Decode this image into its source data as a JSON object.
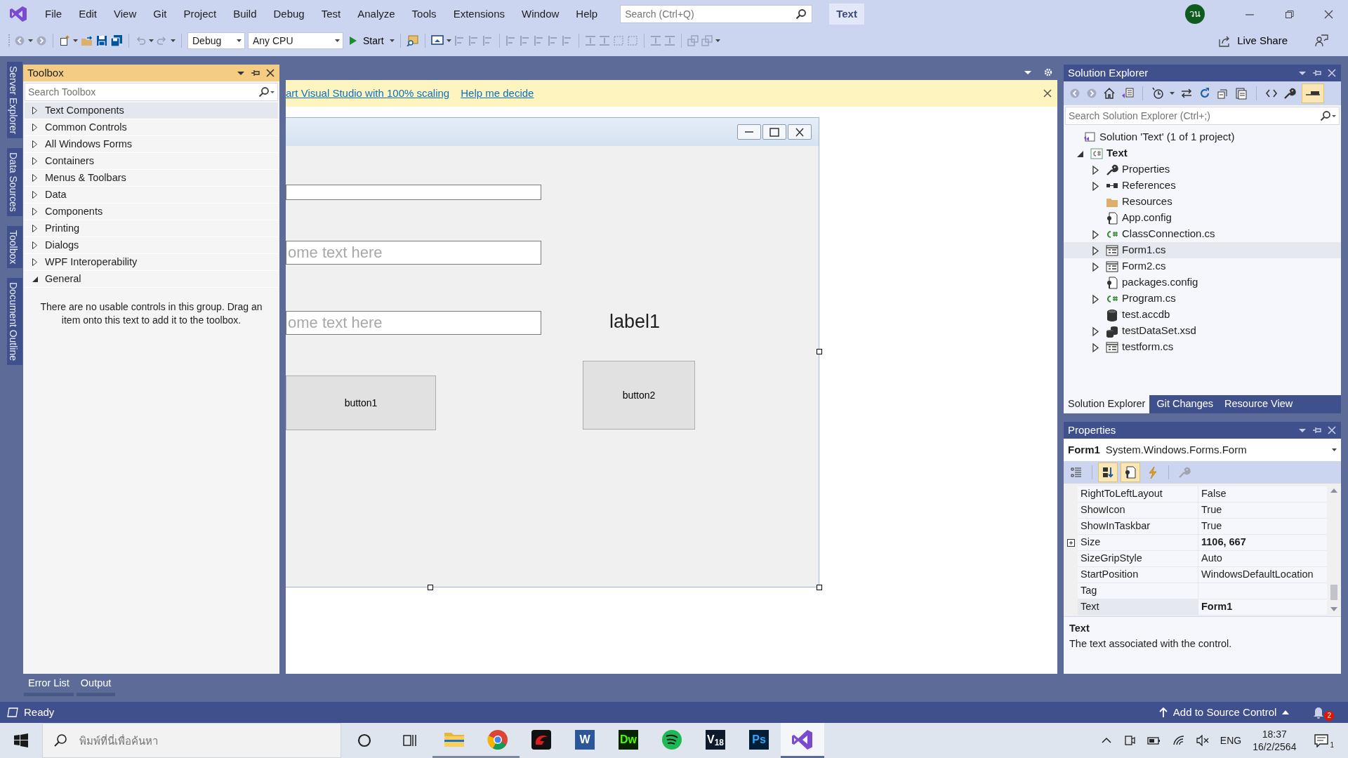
{
  "title_bar": {
    "menu": [
      {
        "label": "File"
      },
      {
        "label": "Edit"
      },
      {
        "label": "View"
      },
      {
        "label": "Git"
      },
      {
        "label": "Project"
      },
      {
        "label": "Build"
      },
      {
        "label": "Debug"
      },
      {
        "label": "Test"
      },
      {
        "label": "Analyze"
      },
      {
        "label": "Tools"
      },
      {
        "label": "Extensions"
      },
      {
        "label": "Window"
      },
      {
        "label": "Help"
      }
    ],
    "search": {
      "placeholder": "Search (Ctrl+Q)"
    },
    "solution_badge": "Text",
    "avatar": "วน"
  },
  "toolbar": {
    "configuration": "Debug",
    "platform": "Any CPU",
    "start": "Start",
    "live_share": "Live Share"
  },
  "side_tabs": [
    {
      "label": "Server Explorer"
    },
    {
      "label": "Data Sources"
    },
    {
      "label": "Toolbox"
    },
    {
      "label": "Document Outline"
    }
  ],
  "toolbox": {
    "title": "Toolbox",
    "search": {
      "placeholder": "Search Toolbox"
    },
    "groups": [
      {
        "label": "Text Components",
        "expanded": false,
        "selected": true
      },
      {
        "label": "Common Controls",
        "expanded": false,
        "selected": false
      },
      {
        "label": "All Windows Forms",
        "expanded": false,
        "selected": false
      },
      {
        "label": "Containers",
        "expanded": false,
        "selected": false
      },
      {
        "label": "Menus & Toolbars",
        "expanded": false,
        "selected": false
      },
      {
        "label": "Data",
        "expanded": false,
        "selected": false
      },
      {
        "label": "Components",
        "expanded": false,
        "selected": false
      },
      {
        "label": "Printing",
        "expanded": false,
        "selected": false
      },
      {
        "label": "Dialogs",
        "expanded": false,
        "selected": false
      },
      {
        "label": "WPF Interoperability",
        "expanded": false,
        "selected": false
      },
      {
        "label": "General",
        "expanded": true,
        "selected": false
      }
    ],
    "empty_message": "There are no usable controls in this group. Drag an item onto this text to add it to the toolbox."
  },
  "designer": {
    "infobar": {
      "message": "art Visual Studio with 100% scaling",
      "link": "Help me decide"
    },
    "form_controls": [
      {
        "kind": "textbox"
      },
      {
        "kind": "textbox",
        "placeholder": "ome text here"
      },
      {
        "kind": "textbox",
        "placeholder": "ome text here"
      },
      {
        "kind": "label",
        "text": "label1"
      },
      {
        "kind": "button",
        "text": "button2"
      },
      {
        "kind": "button",
        "text": "button1"
      }
    ]
  },
  "solution_explorer": {
    "title": "Solution Explorer",
    "preview_toggle": true,
    "search": {
      "placeholder": "Search Solution Explorer (Ctrl+;)"
    },
    "tree": [
      {
        "label": "Solution 'Text' (1 of 1 project)",
        "kind": "solution",
        "expandable": false,
        "selected": false,
        "children": [
          {
            "label": "Text",
            "kind": "project",
            "expandable": true,
            "expanded": true,
            "selected": false,
            "children": [
              {
                "label": "Properties",
                "kind": "wrench",
                "expandable": true,
                "expanded": false,
                "selected": false
              },
              {
                "label": "References",
                "kind": "references",
                "expandable": true,
                "expanded": false,
                "selected": false
              },
              {
                "label": "Resources",
                "kind": "folder",
                "expandable": false,
                "selected": false
              },
              {
                "label": "App.config",
                "kind": "config",
                "expandable": false,
                "selected": false
              },
              {
                "label": "ClassConnection.cs",
                "kind": "csharp",
                "expandable": true,
                "expanded": false,
                "selected": false
              },
              {
                "label": "Form1.cs",
                "kind": "form",
                "expandable": true,
                "expanded": false,
                "selected": true
              },
              {
                "label": "Form2.cs",
                "kind": "form",
                "expandable": true,
                "expanded": false,
                "selected": false
              },
              {
                "label": "packages.config",
                "kind": "config",
                "expandable": false,
                "selected": false
              },
              {
                "label": "Program.cs",
                "kind": "csharp",
                "expandable": true,
                "expanded": false,
                "selected": false
              },
              {
                "label": "test.accdb",
                "kind": "database",
                "expandable": false,
                "selected": false
              },
              {
                "label": "testDataSet.xsd",
                "kind": "dataset",
                "expandable": true,
                "expanded": false,
                "selected": false
              },
              {
                "label": "testform.cs",
                "kind": "form",
                "expandable": true,
                "expanded": false,
                "selected": false
              }
            ]
          }
        ]
      }
    ],
    "tabs": [
      {
        "label": "Solution Explorer",
        "selected": true
      },
      {
        "label": "Git Changes",
        "selected": false
      },
      {
        "label": "Resource View",
        "selected": false
      }
    ]
  },
  "properties": {
    "title": "Properties",
    "object": "Form1",
    "type": "System.Windows.Forms.Form",
    "view_buttons": [
      {
        "kind": "categorized",
        "selected": false
      },
      {
        "kind": "alphabetical",
        "selected": true
      },
      {
        "kind": "property-pages",
        "selected": true
      },
      {
        "kind": "events",
        "selected": false
      },
      {
        "kind": "wrench",
        "selected": false
      }
    ],
    "rows": [
      {
        "name": "RightToLeftLayout",
        "value": "False",
        "modified": false,
        "expandable": false,
        "selected": false
      },
      {
        "name": "ShowIcon",
        "value": "True",
        "modified": false,
        "expandable": false,
        "selected": false
      },
      {
        "name": "ShowInTaskbar",
        "value": "True",
        "modified": false,
        "expandable": false,
        "selected": false
      },
      {
        "name": "Size",
        "value": "1106, 667",
        "modified": true,
        "expandable": true,
        "selected": false
      },
      {
        "name": "SizeGripStyle",
        "value": "Auto",
        "modified": false,
        "expandable": false,
        "selected": false
      },
      {
        "name": "StartPosition",
        "value": "WindowsDefaultLocation",
        "modified": false,
        "expandable": false,
        "selected": false
      },
      {
        "name": "Tag",
        "expandable": false,
        "selected": false
      },
      {
        "name": "Text",
        "value": "Form1",
        "modified": true,
        "expandable": false,
        "selected": true
      }
    ],
    "description": {
      "title": "Text",
      "text": "The text associated with the control."
    }
  },
  "bottom_tabs": [
    {
      "label": "Error List"
    },
    {
      "label": "Output"
    }
  ],
  "status_bar": {
    "text": "Ready",
    "source_control": "Add to Source Control",
    "notifications": "2"
  },
  "taskbar": {
    "search": {
      "placeholder": "พิมพ์ที่นี่เพื่อค้นหา"
    },
    "apps": [
      {
        "kind": "folder",
        "running": true,
        "selected": false
      },
      {
        "kind": "browser",
        "running": true,
        "selected": false
      },
      {
        "kind": "game",
        "running": false,
        "selected": false
      },
      {
        "kind": "tile",
        "glyph": {
          "text": "W",
          "color": "#ffffff"
        },
        "color": "#2b579a",
        "running": false,
        "selected": false
      },
      {
        "kind": "tile",
        "glyph": {
          "text": "Dw",
          "color": "#4bff00"
        },
        "color": "#072401",
        "running": false,
        "selected": false
      },
      {
        "kind": "music",
        "running": false,
        "selected": false
      },
      {
        "kind": "tile",
        "glyph": {
          "text": "V$_{18}$",
          "color": "#ffffff"
        },
        "color": "#0d1a2b",
        "running": false,
        "selected": false
      },
      {
        "kind": "tile",
        "glyph": {
          "text": "Ps",
          "color": "#31a8ff"
        },
        "color": "#001e36",
        "running": false,
        "selected": false
      },
      {
        "kind": "studio",
        "running": true,
        "selected": true
      }
    ],
    "language": "ENG",
    "time": "18:37",
    "date": "16/2/2564",
    "notifications": "1"
  }
}
